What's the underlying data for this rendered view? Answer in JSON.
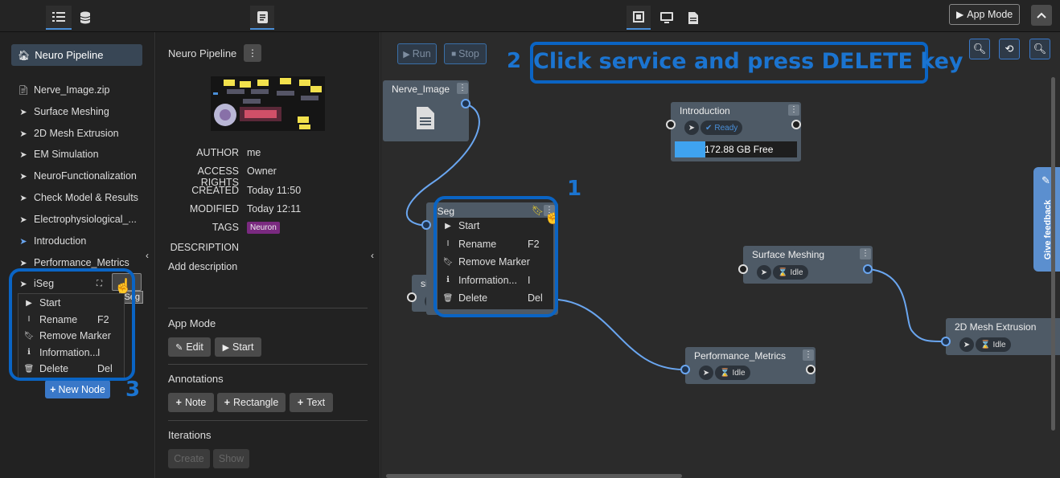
{
  "topbar": {
    "app_mode_label": "App Mode"
  },
  "sidebar": {
    "root_label": "Neuro Pipeline",
    "items": [
      {
        "label": "Nerve_Image.zip",
        "icon": "file-icon"
      },
      {
        "label": "Surface Meshing",
        "icon": "cursor-icon"
      },
      {
        "label": "2D Mesh Extrusion",
        "icon": "cursor-icon"
      },
      {
        "label": "EM Simulation",
        "icon": "cursor-icon"
      },
      {
        "label": "NeuroFunctionalization",
        "icon": "cursor-icon"
      },
      {
        "label": "Check Model & Results",
        "icon": "cursor-icon"
      },
      {
        "label": "Electrophysiological_...",
        "icon": "cursor-icon"
      },
      {
        "label": "Introduction",
        "icon": "cursor-icon"
      },
      {
        "label": "Performance_Metrics",
        "icon": "cursor-icon"
      }
    ],
    "selected_label": "iSeg",
    "tooltip": "iSeg",
    "new_node_label": "New Node"
  },
  "context_menu": {
    "items": [
      {
        "label": "Start",
        "shortcut": ""
      },
      {
        "label": "Rename",
        "shortcut": "F2"
      },
      {
        "label": "Remove Marker",
        "shortcut": ""
      },
      {
        "label": "Information...",
        "shortcut": "I"
      },
      {
        "label": "Delete",
        "shortcut": "Del"
      }
    ]
  },
  "study": {
    "title": "Neuro Pipeline",
    "author_label": "AUTHOR",
    "author": "me",
    "access_label": "ACCESS RIGHTS",
    "access": "Owner",
    "created_label": "CREATED",
    "created": "Today 11:50",
    "modified_label": "MODIFIED",
    "modified": "Today 12:11",
    "tags_label": "TAGS",
    "tag": "Neuron",
    "description_label": "DESCRIPTION",
    "add_description": "Add description",
    "app_mode_heading": "App Mode",
    "edit_label": "Edit",
    "start_label": "Start",
    "annotations_heading": "Annotations",
    "note_label": "Note",
    "rectangle_label": "Rectangle",
    "text_label": "Text",
    "iterations_heading": "Iterations",
    "create_label": "Create",
    "show_label": "Show"
  },
  "workbench": {
    "run_label": "Run",
    "stop_label": "Stop",
    "instruction": "Click service and press DELETE key",
    "step1": "1",
    "step2": "2",
    "step3": "3",
    "feedback_label": "Give feedback"
  },
  "nodes": {
    "nerve": {
      "title": "Nerve_Image"
    },
    "intro": {
      "title": "Introduction",
      "status": "Ready",
      "disk": "172.88 GB Free",
      "disk_fill": 0.25
    },
    "iseg": {
      "title": "iSeg"
    },
    "sim": {
      "title": "sim"
    },
    "surface": {
      "title": "Surface Meshing",
      "status": "Idle"
    },
    "perf": {
      "title": "Performance_Metrics",
      "status": "Idle"
    },
    "mesh2d": {
      "title": "2D Mesh Extrusion",
      "status": "Idle"
    }
  },
  "colors": {
    "accent": "#0a64c4",
    "link": "#6aa6f0",
    "tag": "#7a2a80",
    "ready": "#4a8fd8"
  }
}
